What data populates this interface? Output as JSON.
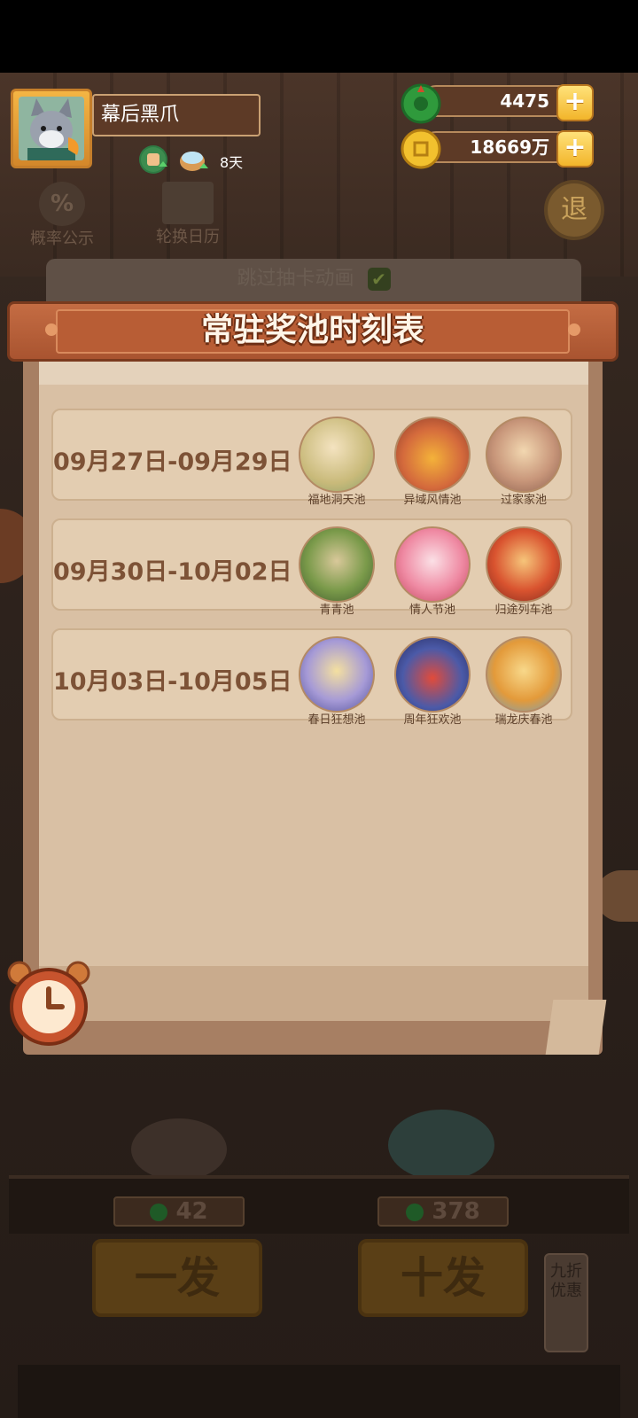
{
  "player": {
    "name": "幕后黑爪",
    "days": "8天",
    "avatar": "wolf-avatar"
  },
  "currency": {
    "jade": "4475",
    "coins": "18669万"
  },
  "toolbar": {
    "probability": "概率公示",
    "rotation": "轮换日历",
    "retreat": "退"
  },
  "skip_animation": {
    "label": "跳过抽卡动画",
    "checked": true
  },
  "modal": {
    "title": "常驻奖池时刻表",
    "rows": [
      {
        "date": "09月27日-09月29日",
        "pools": [
          "福地洞天池",
          "异域风情池",
          "过家家池"
        ]
      },
      {
        "date": "09月30日-10月02日",
        "pools": [
          "青青池",
          "情人节池",
          "归途列车池"
        ]
      },
      {
        "date": "10月03日-10月05日",
        "pools": [
          "春日狂想池",
          "周年狂欢池",
          "瑞龙庆春池"
        ]
      }
    ]
  },
  "pull": {
    "single": {
      "label": "一发",
      "cost": "42"
    },
    "ten": {
      "label": "十发",
      "cost": "378"
    },
    "discount_tag": "九折优惠"
  },
  "colors": {
    "banner": "#b85d35",
    "paper": "#d9c0a4",
    "gold": "#f2b52b",
    "jade": "#3bb34a"
  }
}
